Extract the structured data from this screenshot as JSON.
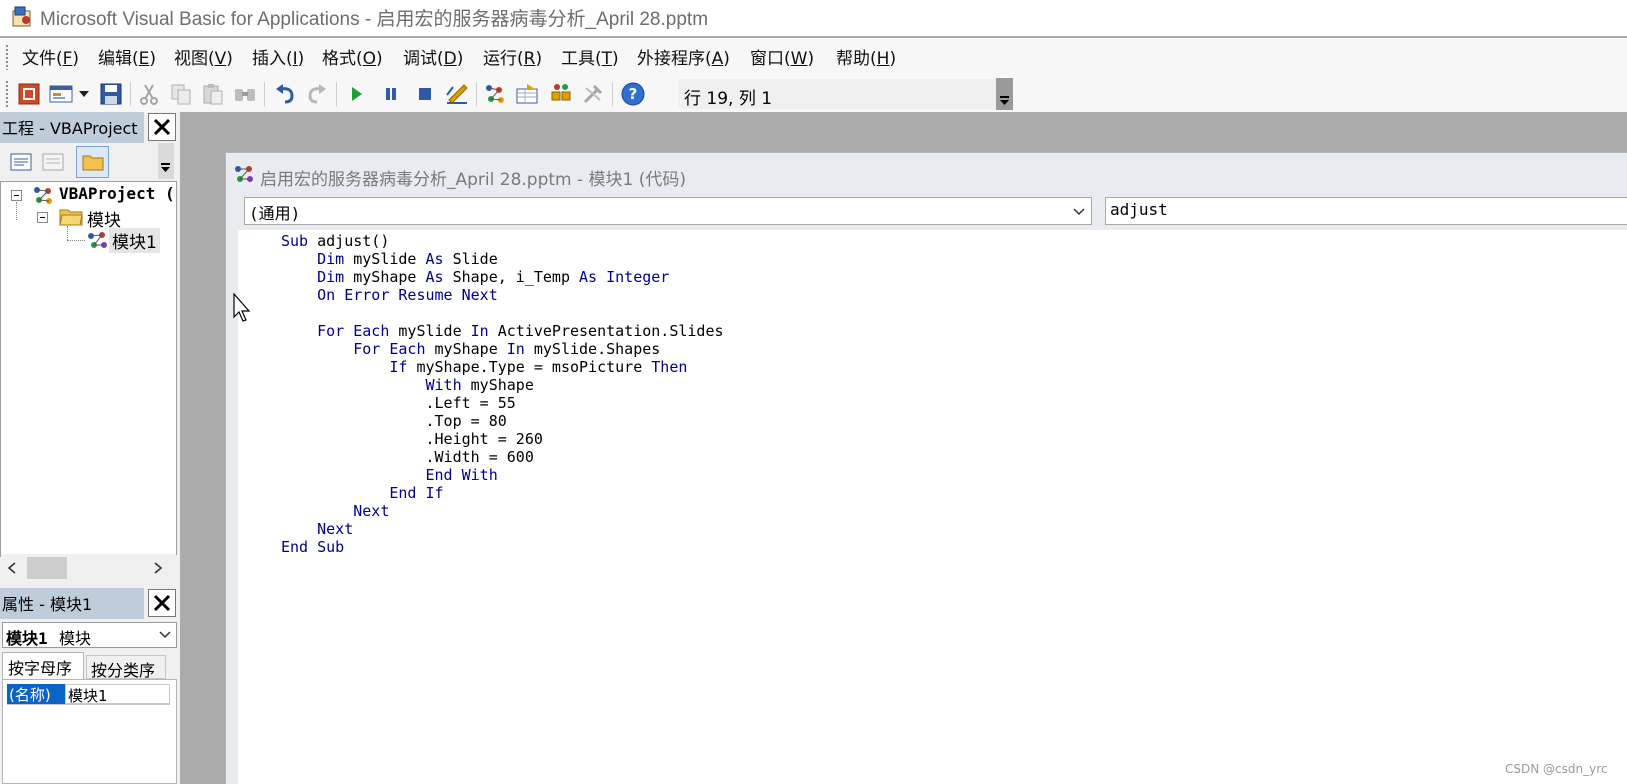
{
  "window": {
    "title": "Microsoft Visual Basic for Applications - 启用宏的服务器病毒分析_April 28.pptm"
  },
  "menu": [
    {
      "label": "文件(",
      "key": "F",
      "tail": ")"
    },
    {
      "label": "编辑(",
      "key": "E",
      "tail": ")"
    },
    {
      "label": "视图(",
      "key": "V",
      "tail": ")"
    },
    {
      "label": "插入(",
      "key": "I",
      "tail": ")"
    },
    {
      "label": "格式(",
      "key": "O",
      "tail": ")"
    },
    {
      "label": "调试(",
      "key": "D",
      "tail": ")"
    },
    {
      "label": "运行(",
      "key": "R",
      "tail": ")"
    },
    {
      "label": "工具(",
      "key": "T",
      "tail": ")"
    },
    {
      "label": "外接程序(",
      "key": "A",
      "tail": ")"
    },
    {
      "label": "窗口(",
      "key": "W",
      "tail": ")"
    },
    {
      "label": "帮助(",
      "key": "H",
      "tail": ")"
    }
  ],
  "toolbar": {
    "position": "行 19, 列 1",
    "icons": [
      "powerpoint-view-icon",
      "insert-userform-icon",
      "dropdown-arrow-icon",
      "save-icon",
      "cut-icon",
      "copy-icon",
      "paste-icon",
      "find-icon",
      "undo-icon",
      "redo-icon",
      "run-icon",
      "break-icon",
      "reset-icon",
      "design-mode-icon",
      "project-explorer-icon",
      "properties-window-icon",
      "object-browser-icon",
      "toolbox-icon",
      "help-icon"
    ]
  },
  "project_panel": {
    "title": "工程 - VBAProject",
    "tree": {
      "root": "VBAProject (",
      "folder": "模块",
      "module": "模块1"
    }
  },
  "properties_panel": {
    "title": "属性 - 模块1",
    "object_name": "模块1",
    "object_type": "模块",
    "tabs": [
      "按字母序",
      "按分类序"
    ],
    "row": {
      "name": "(名称)",
      "value": "模块1"
    }
  },
  "code_window": {
    "title": "启用宏的服务器病毒分析_April 28.pptm - 模块1 (代码)",
    "object_combo": "(通用)",
    "proc_combo": "adjust",
    "lines": [
      [
        {
          "t": "Sub ",
          "k": 1
        },
        {
          "t": "adjust()"
        }
      ],
      [
        {
          "t": "    "
        },
        {
          "t": "Dim ",
          "k": 1
        },
        {
          "t": "mySlide "
        },
        {
          "t": "As ",
          "k": 1
        },
        {
          "t": "Slide"
        }
      ],
      [
        {
          "t": "    "
        },
        {
          "t": "Dim ",
          "k": 1
        },
        {
          "t": "myShape "
        },
        {
          "t": "As ",
          "k": 1
        },
        {
          "t": "Shape, i_Temp "
        },
        {
          "t": "As ",
          "k": 1
        },
        {
          "t": "Integer",
          "k": 1
        }
      ],
      [
        {
          "t": "    "
        },
        {
          "t": "On Error Resume Next",
          "k": 1
        }
      ],
      [
        {
          "t": ""
        }
      ],
      [
        {
          "t": "    "
        },
        {
          "t": "For Each ",
          "k": 1
        },
        {
          "t": "mySlide "
        },
        {
          "t": "In ",
          "k": 1
        },
        {
          "t": "ActivePresentation.Slides"
        }
      ],
      [
        {
          "t": "        "
        },
        {
          "t": "For Each ",
          "k": 1
        },
        {
          "t": "myShape "
        },
        {
          "t": "In ",
          "k": 1
        },
        {
          "t": "mySlide.Shapes"
        }
      ],
      [
        {
          "t": "            "
        },
        {
          "t": "If ",
          "k": 1
        },
        {
          "t": "myShape.Type = msoPicture "
        },
        {
          "t": "Then",
          "k": 1
        }
      ],
      [
        {
          "t": "                "
        },
        {
          "t": "With ",
          "k": 1
        },
        {
          "t": "myShape"
        }
      ],
      [
        {
          "t": "                .Left = 55"
        }
      ],
      [
        {
          "t": "                .Top = 80"
        }
      ],
      [
        {
          "t": "                .Height = 260"
        }
      ],
      [
        {
          "t": "                .Width = 600"
        }
      ],
      [
        {
          "t": "                "
        },
        {
          "t": "End With",
          "k": 1
        }
      ],
      [
        {
          "t": "            "
        },
        {
          "t": "End If",
          "k": 1
        }
      ],
      [
        {
          "t": "        "
        },
        {
          "t": "Next",
          "k": 1
        }
      ],
      [
        {
          "t": "    "
        },
        {
          "t": "Next",
          "k": 1
        }
      ],
      [
        {
          "t": "End Sub",
          "k": 1
        }
      ]
    ]
  },
  "colors": {
    "keyword": "#00008b",
    "panel_title": "#bfcddb",
    "mdi_background": "#ababab"
  },
  "watermark": "CSDN @csdn_yrc"
}
